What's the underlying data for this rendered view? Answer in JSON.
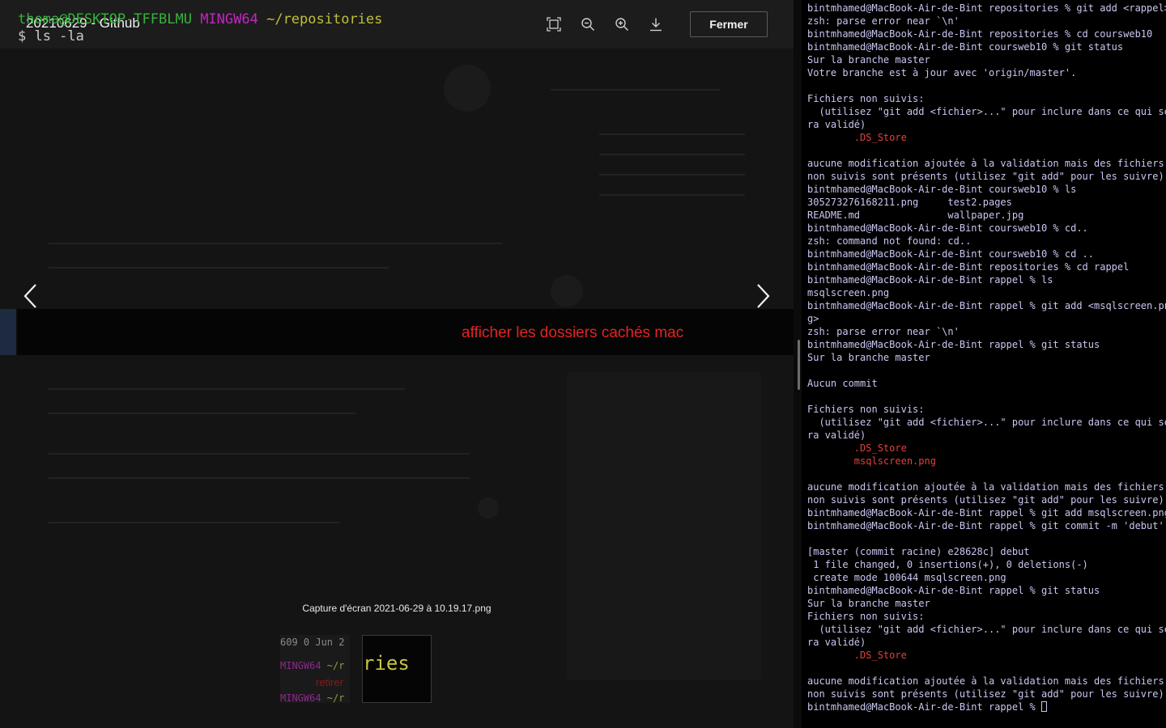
{
  "viewer": {
    "title": "20210629 - Github",
    "close_label": "Fermer",
    "tools": [
      "fullscreen-icon",
      "zoom-out-icon",
      "zoom-in-icon",
      "download-icon"
    ],
    "image": {
      "prompt_user": "thoma@DESKTOP-TFFBLMU",
      "prompt_env": "MINGW64",
      "prompt_path": "~/repositories",
      "command": "$ ls -la",
      "annotation": "afficher les dossiers cachés mac"
    },
    "filename": "Capture d'écran 2021-06-29 à 10.19.17.png",
    "thumbnails": [
      {
        "line1": "609 0 Jun 2",
        "line2_env": "MINGW64",
        "line2_path": " ~/r",
        "line3": "retirer",
        "line4_env": "MINGW64",
        "line4_path": " ~/r"
      },
      {
        "word": "ries"
      }
    ]
  },
  "terminal": {
    "lines": [
      {
        "text": "bintmhamed@MacBook-Air-de-Bint repositories % git add <rappel>"
      },
      {
        "text": "zsh: parse error near `\\n'"
      },
      {
        "text": "bintmhamed@MacBook-Air-de-Bint repositories % cd coursweb10"
      },
      {
        "text": "bintmhamed@MacBook-Air-de-Bint coursweb10 % git status"
      },
      {
        "text": "Sur la branche master"
      },
      {
        "text": "Votre branche est à jour avec 'origin/master'."
      },
      {
        "text": ""
      },
      {
        "text": "Fichiers non suivis:"
      },
      {
        "text": "  (utilisez \"git add <fichier>...\" pour inclure dans ce qui se"
      },
      {
        "text": "ra validé)"
      },
      {
        "text": "        .DS_Store",
        "red": true
      },
      {
        "text": ""
      },
      {
        "text": "aucune modification ajoutée à la validation mais des fichiers"
      },
      {
        "text": "non suivis sont présents (utilisez \"git add\" pour les suivre)"
      },
      {
        "text": "bintmhamed@MacBook-Air-de-Bint coursweb10 % ls"
      },
      {
        "text": "305273276168211.png     test2.pages"
      },
      {
        "text": "README.md               wallpaper.jpg"
      },
      {
        "text": "bintmhamed@MacBook-Air-de-Bint coursweb10 % cd.."
      },
      {
        "text": "zsh: command not found: cd.."
      },
      {
        "text": "bintmhamed@MacBook-Air-de-Bint coursweb10 % cd .."
      },
      {
        "text": "bintmhamed@MacBook-Air-de-Bint repositories % cd rappel"
      },
      {
        "text": "bintmhamed@MacBook-Air-de-Bint rappel % ls"
      },
      {
        "text": "msqlscreen.png"
      },
      {
        "text": "bintmhamed@MacBook-Air-de-Bint rappel % git add <msqlscreen.pn"
      },
      {
        "text": "g>"
      },
      {
        "text": "zsh: parse error near `\\n'"
      },
      {
        "text": "bintmhamed@MacBook-Air-de-Bint rappel % git status"
      },
      {
        "text": "Sur la branche master"
      },
      {
        "text": ""
      },
      {
        "text": "Aucun commit"
      },
      {
        "text": ""
      },
      {
        "text": "Fichiers non suivis:"
      },
      {
        "text": "  (utilisez \"git add <fichier>...\" pour inclure dans ce qui se"
      },
      {
        "text": "ra validé)"
      },
      {
        "text": "        .DS_Store",
        "red": true
      },
      {
        "text": "        msqlscreen.png",
        "red": true
      },
      {
        "text": ""
      },
      {
        "text": "aucune modification ajoutée à la validation mais des fichiers"
      },
      {
        "text": "non suivis sont présents (utilisez \"git add\" pour les suivre)"
      },
      {
        "text": "bintmhamed@MacBook-Air-de-Bint rappel % git add msqlscreen.png"
      },
      {
        "text": "bintmhamed@MacBook-Air-de-Bint rappel % git commit -m 'debut'"
      },
      {
        "text": ""
      },
      {
        "text": "[master (commit racine) e28628c] debut"
      },
      {
        "text": " 1 file changed, 0 insertions(+), 0 deletions(-)"
      },
      {
        "text": " create mode 100644 msqlscreen.png"
      },
      {
        "text": "bintmhamed@MacBook-Air-de-Bint rappel % git status"
      },
      {
        "text": "Sur la branche master"
      },
      {
        "text": "Fichiers non suivis:"
      },
      {
        "text": "  (utilisez \"git add <fichier>...\" pour inclure dans ce qui se"
      },
      {
        "text": "ra validé)"
      },
      {
        "text": "        .DS_Store",
        "red": true
      },
      {
        "text": ""
      },
      {
        "text": "aucune modification ajoutée à la validation mais des fichiers"
      },
      {
        "text": "non suivis sont présents (utilisez \"git add\" pour les suivre)"
      }
    ],
    "prompt": "bintmhamed@MacBook-Air-de-Bint rappel % ",
    "colors": {
      "text": "#c9c7f1",
      "untracked": "#e2413b",
      "background": "#000000"
    }
  }
}
